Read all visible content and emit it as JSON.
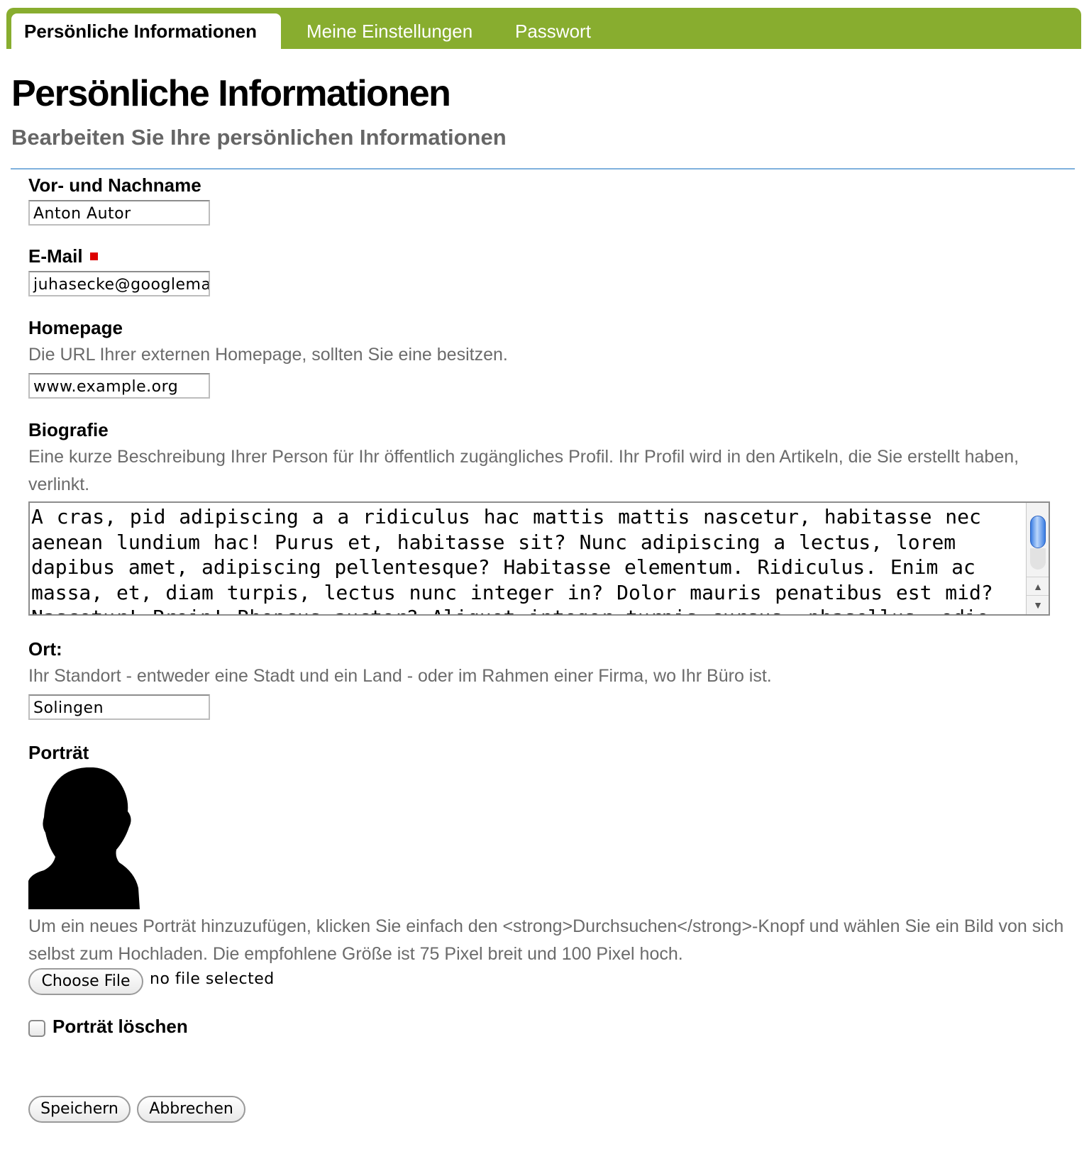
{
  "tabs": [
    {
      "label": "Persönliche Informationen",
      "active": true
    },
    {
      "label": "Meine Einstellungen",
      "active": false
    },
    {
      "label": "Passwort",
      "active": false
    }
  ],
  "page": {
    "title": "Persönliche Informationen",
    "subtitle": "Bearbeiten Sie Ihre persönlichen Informationen"
  },
  "fields": {
    "name": {
      "label": "Vor- und Nachname",
      "value": "Anton Autor"
    },
    "email": {
      "label": "E-Mail",
      "value": "juhasecke@googlemai",
      "required": true
    },
    "homepage": {
      "label": "Homepage",
      "help": "Die URL Ihrer externen Homepage, sollten Sie eine besitzen.",
      "value": "www.example.org"
    },
    "biography": {
      "label": "Biografie",
      "help": "Eine kurze Beschreibung Ihrer Person für Ihr öffentlich zugängliches Profil. Ihr Profil wird in den Artikeln, die Sie erstellt haben, verlinkt.",
      "value": "A cras, pid adipiscing a a ridiculus hac mattis mattis nascetur, habitasse nec aenean lundium hac! Purus et, habitasse sit? Nunc adipiscing a lectus, lorem dapibus amet, adipiscing pellentesque? Habitasse elementum. Ridiculus. Enim ac massa, et, diam turpis, lectus nunc integer in? Dolor mauris penatibus est mid? Nascetur! Proin! Rhoncus auctor? Aliquet integer turpis cursus, phasellus, odio, montes"
    },
    "location": {
      "label": "Ort:",
      "help": "Ihr Standort - entweder eine Stadt und ein Land - oder im Rahmen einer Firma, wo Ihr Büro ist.",
      "value": "Solingen"
    },
    "portrait": {
      "label": "Porträt",
      "help": "Um ein neues Porträt hinzuzufügen, klicken Sie einfach den <strong>Durchsuchen</strong>-Knopf und wählen Sie ein Bild von sich selbst zum Hochladen. Die empfohlene Größe ist 75 Pixel breit und 100 Pixel hoch.",
      "file_button": "Choose File",
      "file_status": "no file selected",
      "delete_label": "Porträt löschen",
      "delete_checked": false
    }
  },
  "actions": {
    "save": "Speichern",
    "cancel": "Abbrechen"
  },
  "colors": {
    "tab_bar": "#88ad2f",
    "divider": "#7fb1dd",
    "required_marker": "#dd0000",
    "help_text": "#6b6b6b",
    "subtitle": "#666666"
  }
}
